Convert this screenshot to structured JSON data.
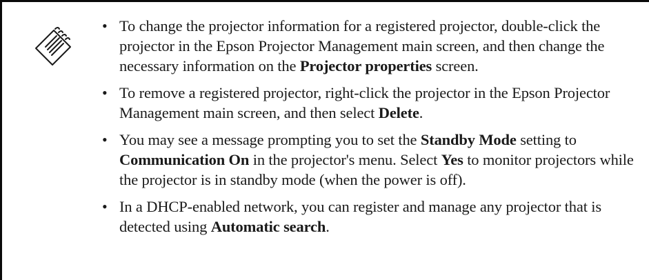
{
  "note": {
    "icon": "note-pad-icon",
    "items": [
      {
        "t1": "To change the projector information for a registered projector, double-click the projector in the Epson Projector Management main screen, and then change the necessary information on the ",
        "b1": "Projector properties",
        "t2": " screen."
      },
      {
        "t1": "To remove a registered projector, right-click the projector in the Epson Projector Management main screen, and then select ",
        "b1": "Delete",
        "t2": "."
      },
      {
        "t1": "You may see a message prompting you to set the ",
        "b1": "Standby Mode",
        "t2": " setting to ",
        "b2": "Communication On",
        "t3": " in the projector's menu. Select ",
        "b3": "Yes",
        "t4": " to monitor projectors while the projector is in standby mode (when the power is off)."
      },
      {
        "t1": "In a DHCP-enabled network, you can register and manage any projector that is detected using ",
        "b1": "Automatic search",
        "t2": "."
      }
    ]
  }
}
